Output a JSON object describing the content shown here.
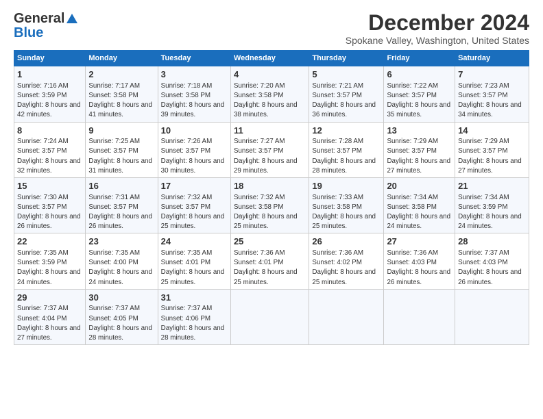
{
  "logo": {
    "line1": "General",
    "line2": "Blue",
    "triangle": "▲"
  },
  "title": "December 2024",
  "subtitle": "Spokane Valley, Washington, United States",
  "headers": [
    "Sunday",
    "Monday",
    "Tuesday",
    "Wednesday",
    "Thursday",
    "Friday",
    "Saturday"
  ],
  "weeks": [
    [
      {
        "day": "1",
        "sunrise": "Sunrise: 7:16 AM",
        "sunset": "Sunset: 3:59 PM",
        "daylight": "Daylight: 8 hours and 42 minutes."
      },
      {
        "day": "2",
        "sunrise": "Sunrise: 7:17 AM",
        "sunset": "Sunset: 3:58 PM",
        "daylight": "Daylight: 8 hours and 41 minutes."
      },
      {
        "day": "3",
        "sunrise": "Sunrise: 7:18 AM",
        "sunset": "Sunset: 3:58 PM",
        "daylight": "Daylight: 8 hours and 39 minutes."
      },
      {
        "day": "4",
        "sunrise": "Sunrise: 7:20 AM",
        "sunset": "Sunset: 3:58 PM",
        "daylight": "Daylight: 8 hours and 38 minutes."
      },
      {
        "day": "5",
        "sunrise": "Sunrise: 7:21 AM",
        "sunset": "Sunset: 3:57 PM",
        "daylight": "Daylight: 8 hours and 36 minutes."
      },
      {
        "day": "6",
        "sunrise": "Sunrise: 7:22 AM",
        "sunset": "Sunset: 3:57 PM",
        "daylight": "Daylight: 8 hours and 35 minutes."
      },
      {
        "day": "7",
        "sunrise": "Sunrise: 7:23 AM",
        "sunset": "Sunset: 3:57 PM",
        "daylight": "Daylight: 8 hours and 34 minutes."
      }
    ],
    [
      {
        "day": "8",
        "sunrise": "Sunrise: 7:24 AM",
        "sunset": "Sunset: 3:57 PM",
        "daylight": "Daylight: 8 hours and 32 minutes."
      },
      {
        "day": "9",
        "sunrise": "Sunrise: 7:25 AM",
        "sunset": "Sunset: 3:57 PM",
        "daylight": "Daylight: 8 hours and 31 minutes."
      },
      {
        "day": "10",
        "sunrise": "Sunrise: 7:26 AM",
        "sunset": "Sunset: 3:57 PM",
        "daylight": "Daylight: 8 hours and 30 minutes."
      },
      {
        "day": "11",
        "sunrise": "Sunrise: 7:27 AM",
        "sunset": "Sunset: 3:57 PM",
        "daylight": "Daylight: 8 hours and 29 minutes."
      },
      {
        "day": "12",
        "sunrise": "Sunrise: 7:28 AM",
        "sunset": "Sunset: 3:57 PM",
        "daylight": "Daylight: 8 hours and 28 minutes."
      },
      {
        "day": "13",
        "sunrise": "Sunrise: 7:29 AM",
        "sunset": "Sunset: 3:57 PM",
        "daylight": "Daylight: 8 hours and 27 minutes."
      },
      {
        "day": "14",
        "sunrise": "Sunrise: 7:29 AM",
        "sunset": "Sunset: 3:57 PM",
        "daylight": "Daylight: 8 hours and 27 minutes."
      }
    ],
    [
      {
        "day": "15",
        "sunrise": "Sunrise: 7:30 AM",
        "sunset": "Sunset: 3:57 PM",
        "daylight": "Daylight: 8 hours and 26 minutes."
      },
      {
        "day": "16",
        "sunrise": "Sunrise: 7:31 AM",
        "sunset": "Sunset: 3:57 PM",
        "daylight": "Daylight: 8 hours and 26 minutes."
      },
      {
        "day": "17",
        "sunrise": "Sunrise: 7:32 AM",
        "sunset": "Sunset: 3:57 PM",
        "daylight": "Daylight: 8 hours and 25 minutes."
      },
      {
        "day": "18",
        "sunrise": "Sunrise: 7:32 AM",
        "sunset": "Sunset: 3:58 PM",
        "daylight": "Daylight: 8 hours and 25 minutes."
      },
      {
        "day": "19",
        "sunrise": "Sunrise: 7:33 AM",
        "sunset": "Sunset: 3:58 PM",
        "daylight": "Daylight: 8 hours and 25 minutes."
      },
      {
        "day": "20",
        "sunrise": "Sunrise: 7:34 AM",
        "sunset": "Sunset: 3:58 PM",
        "daylight": "Daylight: 8 hours and 24 minutes."
      },
      {
        "day": "21",
        "sunrise": "Sunrise: 7:34 AM",
        "sunset": "Sunset: 3:59 PM",
        "daylight": "Daylight: 8 hours and 24 minutes."
      }
    ],
    [
      {
        "day": "22",
        "sunrise": "Sunrise: 7:35 AM",
        "sunset": "Sunset: 3:59 PM",
        "daylight": "Daylight: 8 hours and 24 minutes."
      },
      {
        "day": "23",
        "sunrise": "Sunrise: 7:35 AM",
        "sunset": "Sunset: 4:00 PM",
        "daylight": "Daylight: 8 hours and 24 minutes."
      },
      {
        "day": "24",
        "sunrise": "Sunrise: 7:35 AM",
        "sunset": "Sunset: 4:01 PM",
        "daylight": "Daylight: 8 hours and 25 minutes."
      },
      {
        "day": "25",
        "sunrise": "Sunrise: 7:36 AM",
        "sunset": "Sunset: 4:01 PM",
        "daylight": "Daylight: 8 hours and 25 minutes."
      },
      {
        "day": "26",
        "sunrise": "Sunrise: 7:36 AM",
        "sunset": "Sunset: 4:02 PM",
        "daylight": "Daylight: 8 hours and 25 minutes."
      },
      {
        "day": "27",
        "sunrise": "Sunrise: 7:36 AM",
        "sunset": "Sunset: 4:03 PM",
        "daylight": "Daylight: 8 hours and 26 minutes."
      },
      {
        "day": "28",
        "sunrise": "Sunrise: 7:37 AM",
        "sunset": "Sunset: 4:03 PM",
        "daylight": "Daylight: 8 hours and 26 minutes."
      }
    ],
    [
      {
        "day": "29",
        "sunrise": "Sunrise: 7:37 AM",
        "sunset": "Sunset: 4:04 PM",
        "daylight": "Daylight: 8 hours and 27 minutes."
      },
      {
        "day": "30",
        "sunrise": "Sunrise: 7:37 AM",
        "sunset": "Sunset: 4:05 PM",
        "daylight": "Daylight: 8 hours and 28 minutes."
      },
      {
        "day": "31",
        "sunrise": "Sunrise: 7:37 AM",
        "sunset": "Sunset: 4:06 PM",
        "daylight": "Daylight: 8 hours and 28 minutes."
      },
      null,
      null,
      null,
      null
    ]
  ]
}
